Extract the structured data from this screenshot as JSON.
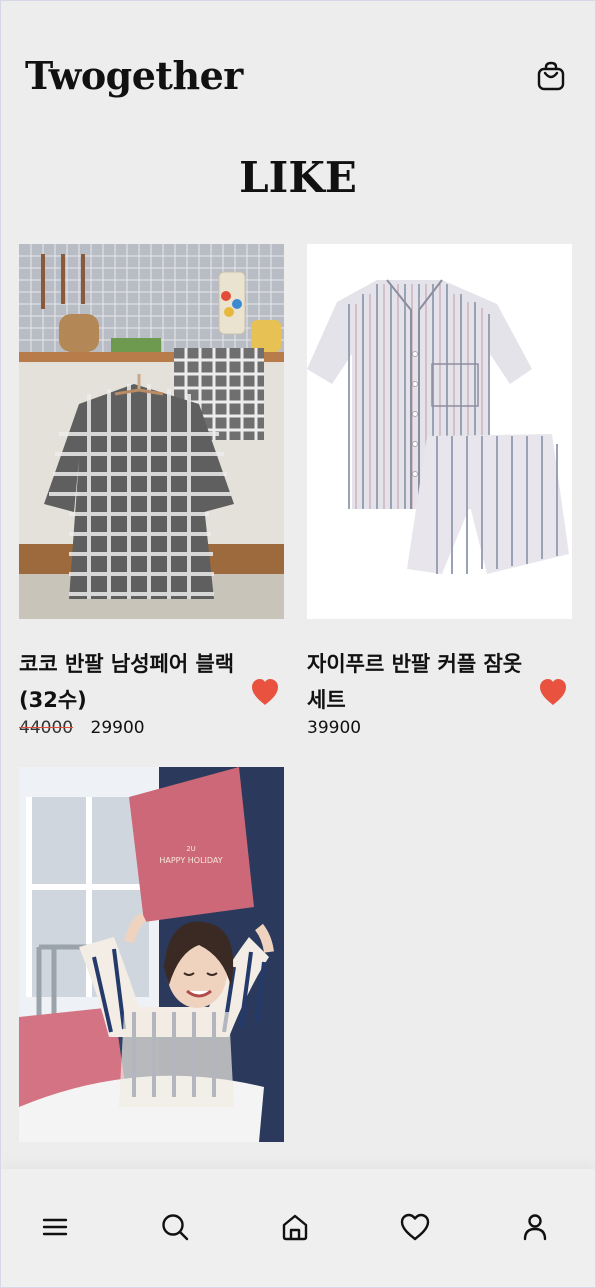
{
  "header": {
    "logo": "Twogether",
    "cart_icon": "shopping-bag-icon"
  },
  "page": {
    "title": "LIKE"
  },
  "products": [
    {
      "name": "코코 반팔 남성페어 블랙 (32수)",
      "old_price": "44000",
      "price": "29900",
      "liked": true
    },
    {
      "name": "자이푸르 반팔 커플 잠옷 세트",
      "old_price": "",
      "price": "39900",
      "liked": true
    },
    {
      "name": "",
      "old_price": "",
      "price": "",
      "image_text": {
        "brand": "2U",
        "title": "HAPPY HOLIDAY"
      }
    }
  ],
  "colors": {
    "background": "#ededed",
    "heart": "#e8523f",
    "text": "#111111"
  },
  "bottom_nav": [
    "menu-icon",
    "search-icon",
    "home-icon",
    "heart-icon",
    "user-icon"
  ]
}
